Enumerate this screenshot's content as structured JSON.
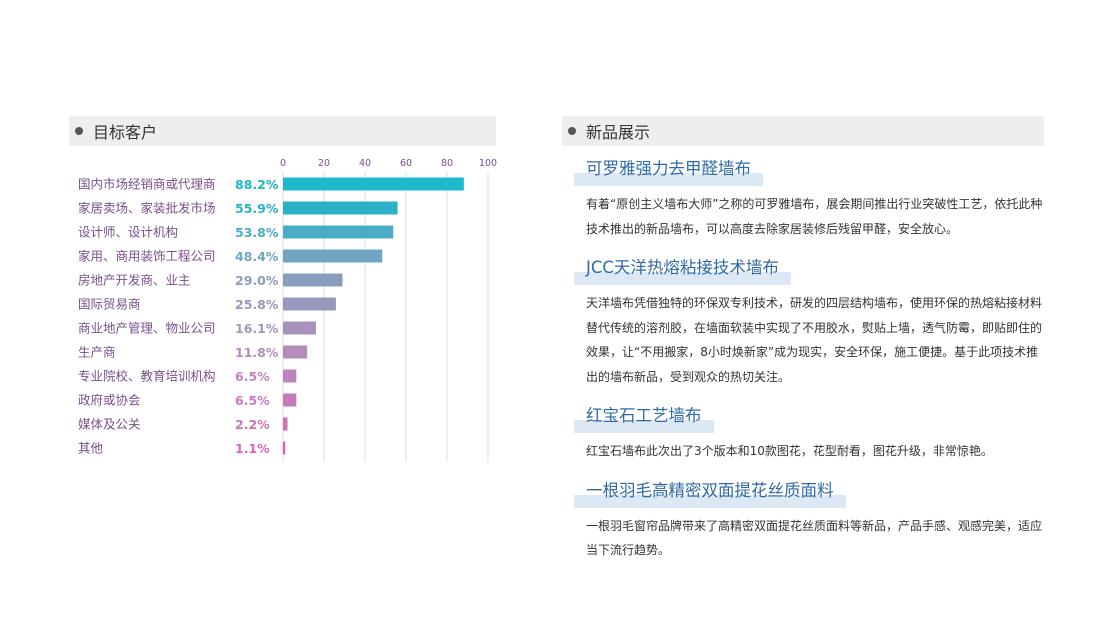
{
  "left_section": {
    "title": "目标客户"
  },
  "right_section": {
    "title": "新品展示"
  },
  "chart_data": {
    "type": "bar",
    "orientation": "horizontal",
    "xlim": [
      0,
      100
    ],
    "xticks": [
      "0",
      "20",
      "40",
      "60",
      "80",
      "100"
    ],
    "grid": true,
    "categories": [
      "国内市场经销商或代理商",
      "家居卖场、家装批发市场",
      "设计师、设计机构",
      "家用、商用装饰工程公司",
      "房地产开发商、业主",
      "国际贸易商",
      "商业地产管理、物业公司",
      "生产商",
      "专业院校、教育培训机构",
      "政府或协会",
      "媒体及公关",
      "其他"
    ],
    "values": [
      88.2,
      55.9,
      53.8,
      48.4,
      29.0,
      25.8,
      16.1,
      11.8,
      6.5,
      6.5,
      2.2,
      1.1
    ],
    "value_labels": [
      "88.2%",
      "55.9%",
      "53.8%",
      "48.4%",
      "29.0%",
      "25.8%",
      "16.1%",
      "11.8%",
      "6.5%",
      "6.5%",
      "2.2%",
      "1.1%"
    ],
    "colors": [
      "#1db8c9",
      "#29b1c8",
      "#4aabc6",
      "#70a4c2",
      "#8a9dbd",
      "#9798bb",
      "#a792bb",
      "#b48bbb",
      "#bf82ba",
      "#c67bb8",
      "#cf72b6",
      "#d767b4"
    ],
    "label_color": "#7a4f8e",
    "grid_color": "#dcdce6"
  },
  "products": [
    {
      "title": "可罗雅强力去甲醛墙布",
      "desc": "有着“原创主义墙布大师”之称的可罗雅墙布，展会期间推出行业突破性工艺，依托此种技术推出的新品墙布，可以高度去除家居装修后残留甲醛，安全放心。"
    },
    {
      "title": "JCC天洋热熔粘接技术墙布",
      "desc": "天洋墙布凭借独特的环保双专利技术，研发的四层结构墙布，使用环保的热熔粘接材料替代传统的溶剂胶，在墙面软装中实现了不用胶水，熨贴上墙，透气防霉，即贴即住的效果，让“不用搬家，8小时焕新家”成为现实，安全环保，施工便捷。基于此项技术推出的墙布新品，受到观众的热切关注。"
    },
    {
      "title": "红宝石工艺墙布",
      "desc": "红宝石墙布此次出了3个版本和10款图花，花型耐看，图花升级，非常惊艳。"
    },
    {
      "title": "一根羽毛高精密双面提花丝质面料",
      "desc": "一根羽毛窗帘品牌带来了高精密双面提花丝质面料等新品，产品手感、观感完美，适应当下流行趋势。"
    }
  ]
}
